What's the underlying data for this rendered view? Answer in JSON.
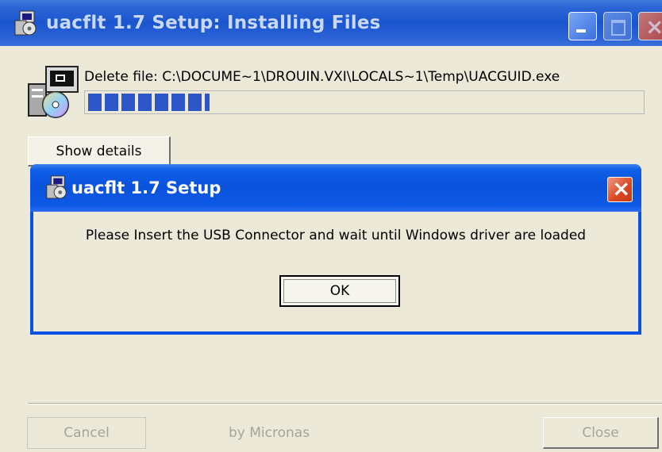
{
  "main_window": {
    "title": "uacflt 1.7 Setup: Installing Files",
    "status_text": "Delete file: C:\\DOCUME~1\\DROUIN.VXI\\LOCALS~1\\Temp\\UACGUID.exe",
    "progress_fraction": 0.22,
    "show_details_label": "Show details",
    "cancel_label": "Cancel",
    "branding": "by Micronas",
    "close_label": "Close"
  },
  "dialog": {
    "title": "uacflt 1.7 Setup",
    "message": "Please Insert the USB Connector and wait until Windows driver are loaded",
    "ok_label": "OK"
  },
  "colors": {
    "titlebar": "#2a64d4",
    "progress": "#2f56c6",
    "dialog_border": "#0a53e0",
    "close_red": "#d9451f",
    "window_bg": "#ece9d8"
  },
  "icons": [
    "setup-app-icon",
    "minimize-icon",
    "maximize-icon",
    "close-icon",
    "installer-cd-icon"
  ]
}
